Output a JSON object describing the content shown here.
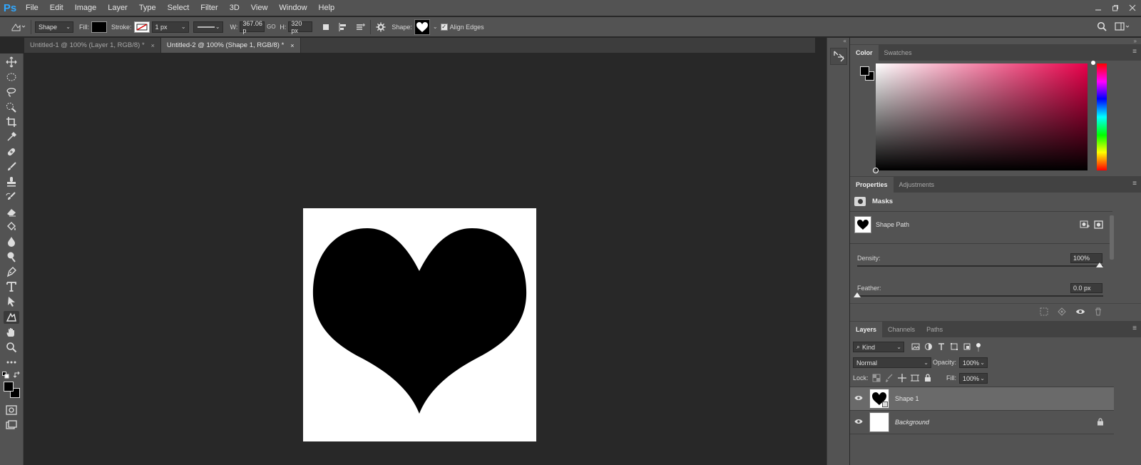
{
  "app": {
    "logo": "Ps"
  },
  "menu": [
    "File",
    "Edit",
    "Image",
    "Layer",
    "Type",
    "Select",
    "Filter",
    "3D",
    "View",
    "Window",
    "Help"
  ],
  "options": {
    "mode": "Shape",
    "fill_label": "Fill:",
    "stroke_label": "Stroke:",
    "stroke_width": "1 px",
    "w_label": "W:",
    "w_value": "367.06 p",
    "link": "GO",
    "h_label": "H:",
    "h_value": "320 px",
    "shape_label": "Shape:",
    "align_edges": "Align Edges",
    "fill_color": "#000000"
  },
  "tabs": [
    {
      "label": "Untitled-1 @ 100% (Layer 1, RGB/8) *",
      "close": "×"
    },
    {
      "label": "Untitled-2 @ 100% (Shape 1, RGB/8) *",
      "close": "×"
    }
  ],
  "color_panel": {
    "tabs": [
      "Color",
      "Swatches"
    ],
    "foreground": "#000000",
    "background": "#ffffff"
  },
  "properties": {
    "tabs": [
      "Properties",
      "Adjustments"
    ],
    "section": "Masks",
    "shape_path": "Shape Path",
    "density_label": "Density:",
    "density_value": "100%",
    "feather_label": "Feather:",
    "feather_value": "0.0 px"
  },
  "layers": {
    "tabs": [
      "Layers",
      "Channels",
      "Paths"
    ],
    "filter": "Kind",
    "blend_mode": "Normal",
    "opacity_label": "Opacity:",
    "opacity_value": "100%",
    "lock_label": "Lock:",
    "fill_label": "Fill:",
    "fill_value": "100%",
    "items": [
      {
        "name": "Shape 1"
      },
      {
        "name": "Background"
      }
    ]
  },
  "icons": {
    "color_accent": "#31a8ff"
  }
}
